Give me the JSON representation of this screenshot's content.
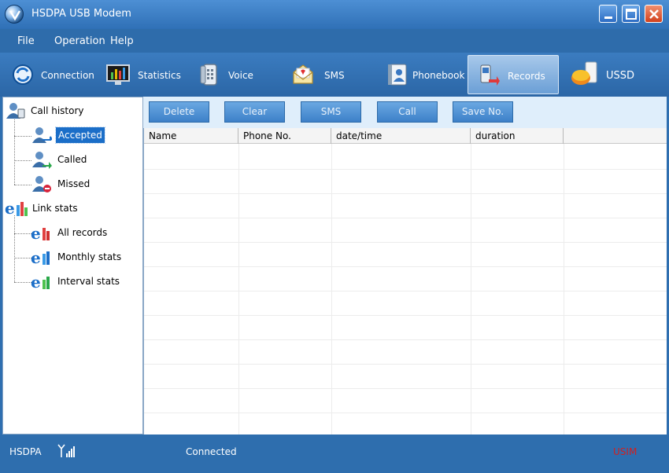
{
  "window": {
    "title": "HSDPA USB Modem"
  },
  "menu": [
    "File",
    "Operation",
    "Help"
  ],
  "toolbar": {
    "active": "Records",
    "items": [
      {
        "label": "Connection",
        "icon": "connection-icon"
      },
      {
        "label": "Statistics",
        "icon": "statistics-icon"
      },
      {
        "label": "Voice",
        "icon": "phone-icon"
      },
      {
        "label": "SMS",
        "icon": "envelope-icon"
      },
      {
        "label": "Phonebook",
        "icon": "phonebook-icon"
      },
      {
        "label": "Records",
        "icon": "records-icon"
      },
      {
        "label": "USSD",
        "icon": "ussd-icon"
      }
    ]
  },
  "tree": {
    "call_history": {
      "label": "Call history",
      "children": [
        "Accepted",
        "Called",
        "Missed"
      ],
      "selected": "Accepted"
    },
    "link_stats": {
      "label": "Link stats",
      "children": [
        "All records",
        "Monthly stats",
        "Interval stats"
      ]
    }
  },
  "actions": [
    "Delete",
    "Clear",
    "SMS",
    "Call",
    "Save No."
  ],
  "table": {
    "columns": [
      "Name",
      "Phone No.",
      "date/time",
      "duration"
    ],
    "rows": []
  },
  "status": {
    "network": "HSDPA",
    "connection": "Connected",
    "sim": "USIM",
    "sim_color": "#d02020"
  },
  "colors": {
    "title_bar": "#2f70b6",
    "toolbar": "#2b66a6",
    "selected": "#1b6ec8",
    "action_button": "#3d80c8"
  }
}
